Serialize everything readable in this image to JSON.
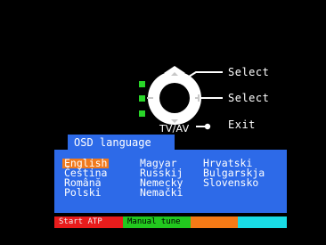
{
  "remote": {
    "callouts": {
      "top": "Select",
      "middle": "Select",
      "bottom": "Exit"
    },
    "tv_av_label": "TV/AV"
  },
  "osd": {
    "title": "OSD language",
    "selected_language": "English",
    "columns": [
      [
        "English",
        "Čeština",
        "Română",
        "Polski"
      ],
      [
        "Magyar",
        "Russkij",
        "Nemecky",
        "Nemački"
      ],
      [
        "Hrvatski",
        "Bulgarskja",
        "Slovensko"
      ]
    ]
  },
  "function_bar": {
    "keys": [
      {
        "label": "Start ATP",
        "color": "#e81c1c",
        "text_color": "#f0f0f0"
      },
      {
        "label": "Manual tune",
        "color": "#22c81e",
        "text_color": "#000000"
      },
      {
        "label": "",
        "color": "#f57a16",
        "text_color": "#000000"
      },
      {
        "label": "",
        "color": "#19dce6",
        "text_color": "#000000"
      }
    ]
  },
  "colors": {
    "background": "#000000",
    "panel": "#2d6ae8",
    "highlight": "#f07a1e",
    "indicator": "#29d629"
  },
  "icons": [
    "remote-dpad-icon",
    "up-arrow-icon",
    "down-arrow-icon",
    "plus-icon",
    "minus-icon"
  ]
}
